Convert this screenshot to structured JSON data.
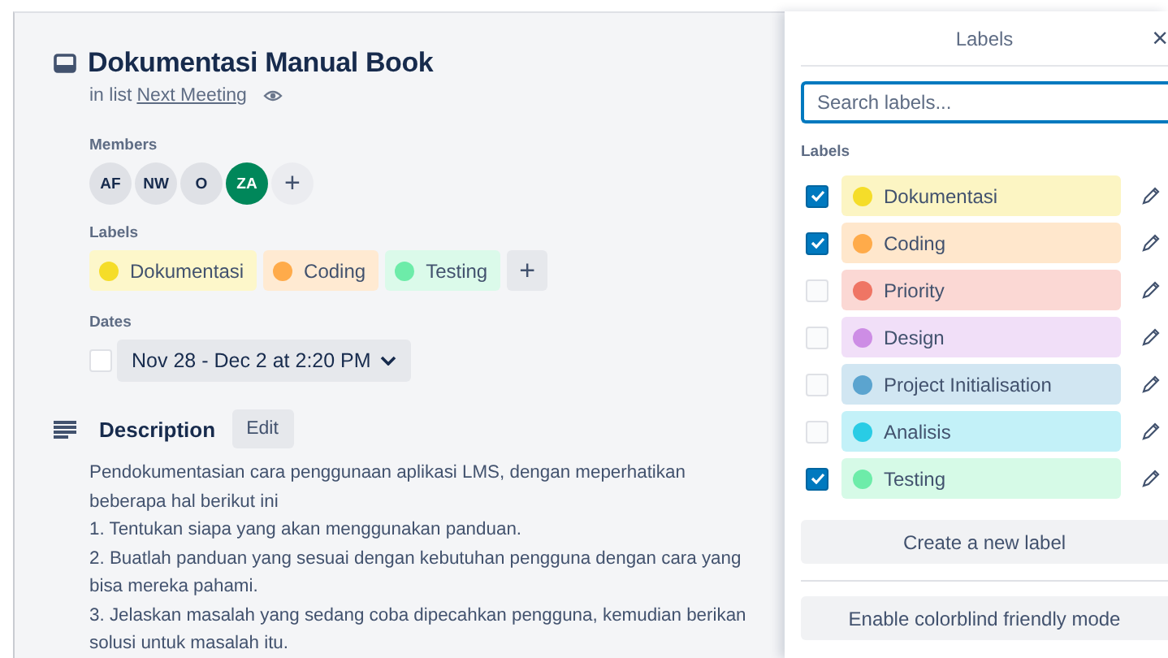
{
  "card": {
    "title": "Dokumentasi Manual Book",
    "list_prefix": "in list",
    "list_name": "Next Meeting",
    "members_heading": "Members",
    "members": [
      {
        "initials": "AF",
        "color": "#dfe1e6"
      },
      {
        "initials": "NW",
        "color": "#dfe1e6"
      },
      {
        "initials": "O",
        "color": "#dfe1e6"
      },
      {
        "initials": "ZA",
        "color": "#00875a"
      }
    ],
    "add_member": "+",
    "labels_heading": "Labels",
    "labels": [
      {
        "name": "Dokumentasi",
        "color": "#f5dd29"
      },
      {
        "name": "Coding",
        "color": "#ffab4a"
      },
      {
        "name": "Testing",
        "color": "#6deca9"
      }
    ],
    "add_label": "+",
    "dates_heading": "Dates",
    "due_complete": false,
    "dates": "Nov 28 - Dec 2 at 2:20 PM",
    "description_heading": "Description",
    "edit_button": "Edit",
    "description": [
      "Pendokumentasian cara penggunaan aplikasi LMS, dengan meperhatikan beberapa hal berikut ini",
      "1. Tentukan siapa yang akan menggunakan panduan.",
      "2. Buatlah panduan yang sesuai dengan kebutuhan pengguna dengan cara yang bisa mereka pahami.",
      "3. Jelaskan masalah yang sedang coba dipecahkan pengguna, kemudian berikan solusi untuk masalah itu."
    ]
  },
  "popover": {
    "title": "Labels",
    "close": "×",
    "search": {
      "placeholder": "Search labels..."
    },
    "heading": "Labels",
    "labels": [
      {
        "name": "Dokumentasi",
        "color": "#f5dd29",
        "checked": true
      },
      {
        "name": "Coding",
        "color": "#ffab4a",
        "checked": true
      },
      {
        "name": "Priority",
        "color": "#ef7564",
        "checked": false
      },
      {
        "name": "Design",
        "color": "#cd8de5",
        "checked": false
      },
      {
        "name": "Project Initialisation",
        "color": "#5ba4cf",
        "checked": false
      },
      {
        "name": "Analisis",
        "color": "#29cce5",
        "checked": false
      },
      {
        "name": "Testing",
        "color": "#6deca9",
        "checked": true
      }
    ],
    "create_button": "Create a new label",
    "colorblind_button": "Enable colorblind friendly mode"
  }
}
